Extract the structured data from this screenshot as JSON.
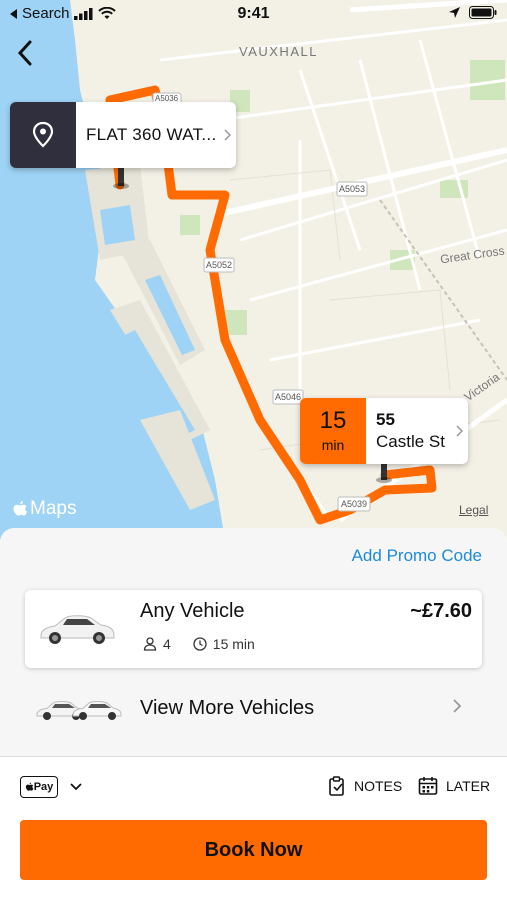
{
  "status_bar": {
    "back_app": "Search",
    "time": "9:41"
  },
  "map": {
    "labels": {
      "vauxhall": "VAUXHALL",
      "great_cross": "Great Cross",
      "victoria": "Victoria",
      "a5053": "A5053",
      "a5052": "A5052",
      "a5046": "A5046",
      "a5039": "A5039",
      "a5036": "A5036"
    },
    "route_color": "#ff6b00",
    "brand": "Maps",
    "legal": "Legal"
  },
  "pickup": {
    "label": "FLAT 360 WAT..."
  },
  "destination": {
    "eta_value": "15",
    "eta_unit": "min",
    "line1": "55",
    "line2": "Castle St"
  },
  "sheet": {
    "promo_link": "Add Promo Code",
    "vehicle": {
      "name": "Any Vehicle",
      "price": "~£7.60",
      "passengers": "4",
      "eta": "15 min"
    },
    "more_vehicles": "View More Vehicles",
    "payment": {
      "method": "Pay"
    },
    "notes_label": "NOTES",
    "later_label": "LATER",
    "book_button": "Book Now"
  },
  "colors": {
    "accent": "#ff6b00",
    "link": "#1f8ad8",
    "pickup_icon_bg": "#2f2f3d",
    "water": "#9ed3f5"
  }
}
